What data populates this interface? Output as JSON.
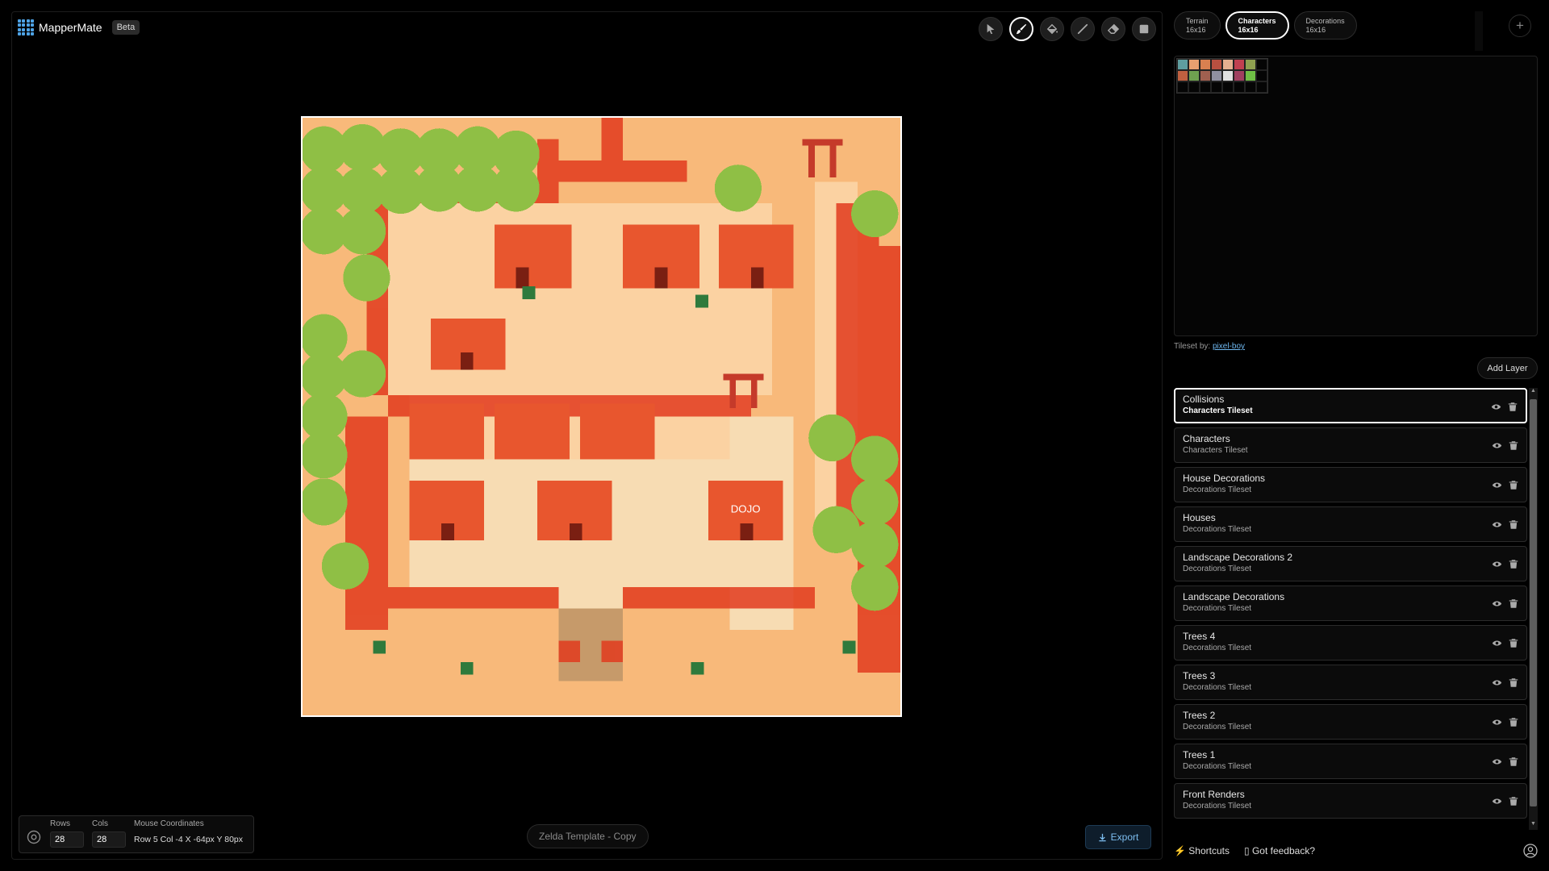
{
  "app": {
    "name": "MapperMate",
    "badge": "Beta"
  },
  "toolbar": {
    "tools": [
      "select-tool",
      "brush-tool",
      "fill-tool",
      "line-tool",
      "eraser-tool",
      "rectangle-tool"
    ],
    "active": "brush-tool"
  },
  "tileset_tabs": [
    {
      "name": "Terrain",
      "size": "16x16",
      "active": false
    },
    {
      "name": "Characters",
      "size": "16x16",
      "active": true
    },
    {
      "name": "Decorations",
      "size": "16x16",
      "active": false
    }
  ],
  "add_tab_label": "+",
  "tileset_credit": {
    "prefix": "Tileset by:",
    "author": "pixel-boy"
  },
  "add_layer_label": "Add Layer",
  "layers": [
    {
      "name": "Collisions",
      "tileset": "Characters Tileset",
      "active": true
    },
    {
      "name": "Characters",
      "tileset": "Characters Tileset",
      "active": false
    },
    {
      "name": "House Decorations",
      "tileset": "Decorations Tileset",
      "active": false
    },
    {
      "name": "Houses",
      "tileset": "Decorations Tileset",
      "active": false
    },
    {
      "name": "Landscape Decorations 2",
      "tileset": "Decorations Tileset",
      "active": false
    },
    {
      "name": "Landscape Decorations",
      "tileset": "Decorations Tileset",
      "active": false
    },
    {
      "name": "Trees 4",
      "tileset": "Decorations Tileset",
      "active": false
    },
    {
      "name": "Trees 3",
      "tileset": "Decorations Tileset",
      "active": false
    },
    {
      "name": "Trees 2",
      "tileset": "Decorations Tileset",
      "active": false
    },
    {
      "name": "Trees 1",
      "tileset": "Decorations Tileset",
      "active": false
    },
    {
      "name": "Front Renders",
      "tileset": "Decorations Tileset",
      "active": false
    }
  ],
  "stats": {
    "rows_label": "Rows",
    "rows": "28",
    "cols_label": "Cols",
    "cols": "28",
    "mouse_label": "Mouse Coordinates",
    "mouse_value": "Row 5   Col -4   X -64px   Y 80px"
  },
  "map_name": "Zelda Template - Copy",
  "export_label": "Export",
  "footer": {
    "shortcuts": "Shortcuts",
    "feedback": "Got feedback?"
  },
  "map": {
    "dojo_sign": "DOJO"
  },
  "colors": {
    "sand": "#f8b97a",
    "path": "#f7dcb3",
    "tree": "#8fbf45",
    "collision": "#e23b1e",
    "roof": "#e8562e",
    "accent": "#6fb8f0"
  }
}
